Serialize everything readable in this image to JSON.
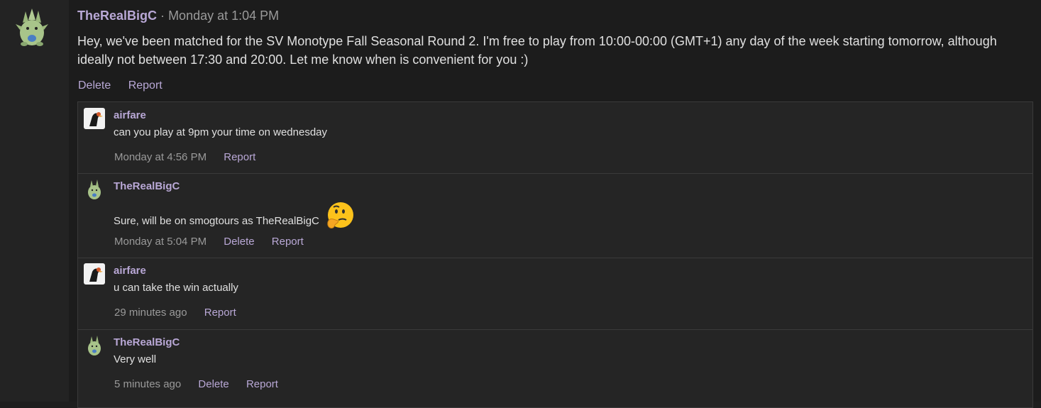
{
  "post": {
    "author": "TheRealBigC",
    "separator": "·",
    "time": "Monday at 1:04 PM",
    "body": "Hey, we've been matched for the SV Monotype Fall Seasonal Round 2. I'm free to play from 10:00-00:00 (GMT+1) any day of the week starting tomorrow, although ideally not between 17:30 and 20:00. Let me know when is convenient for you :)",
    "actions": {
      "delete": "Delete",
      "report": "Report"
    }
  },
  "replies": [
    {
      "author": "airfare",
      "text": "can you play at 9pm your time on wednesday",
      "time": "Monday at 4:56 PM",
      "report": "Report"
    },
    {
      "author": "TheRealBigC",
      "text": "Sure, will be on smogtours as TheRealBigC",
      "emoji": "thinking-face-icon",
      "time": "Monday at 5:04 PM",
      "delete": "Delete",
      "report": "Report"
    },
    {
      "author": "airfare",
      "text": "u can take the win actually",
      "time": "29 minutes ago",
      "report": "Report"
    },
    {
      "author": "TheRealBigC",
      "text": "Very well",
      "time": "5 minutes ago",
      "delete": "Delete",
      "report": "Report"
    }
  ],
  "colors": {
    "username": "#b9a8d6",
    "background": "#1e1e1e",
    "muted": "#9a9a9a"
  }
}
